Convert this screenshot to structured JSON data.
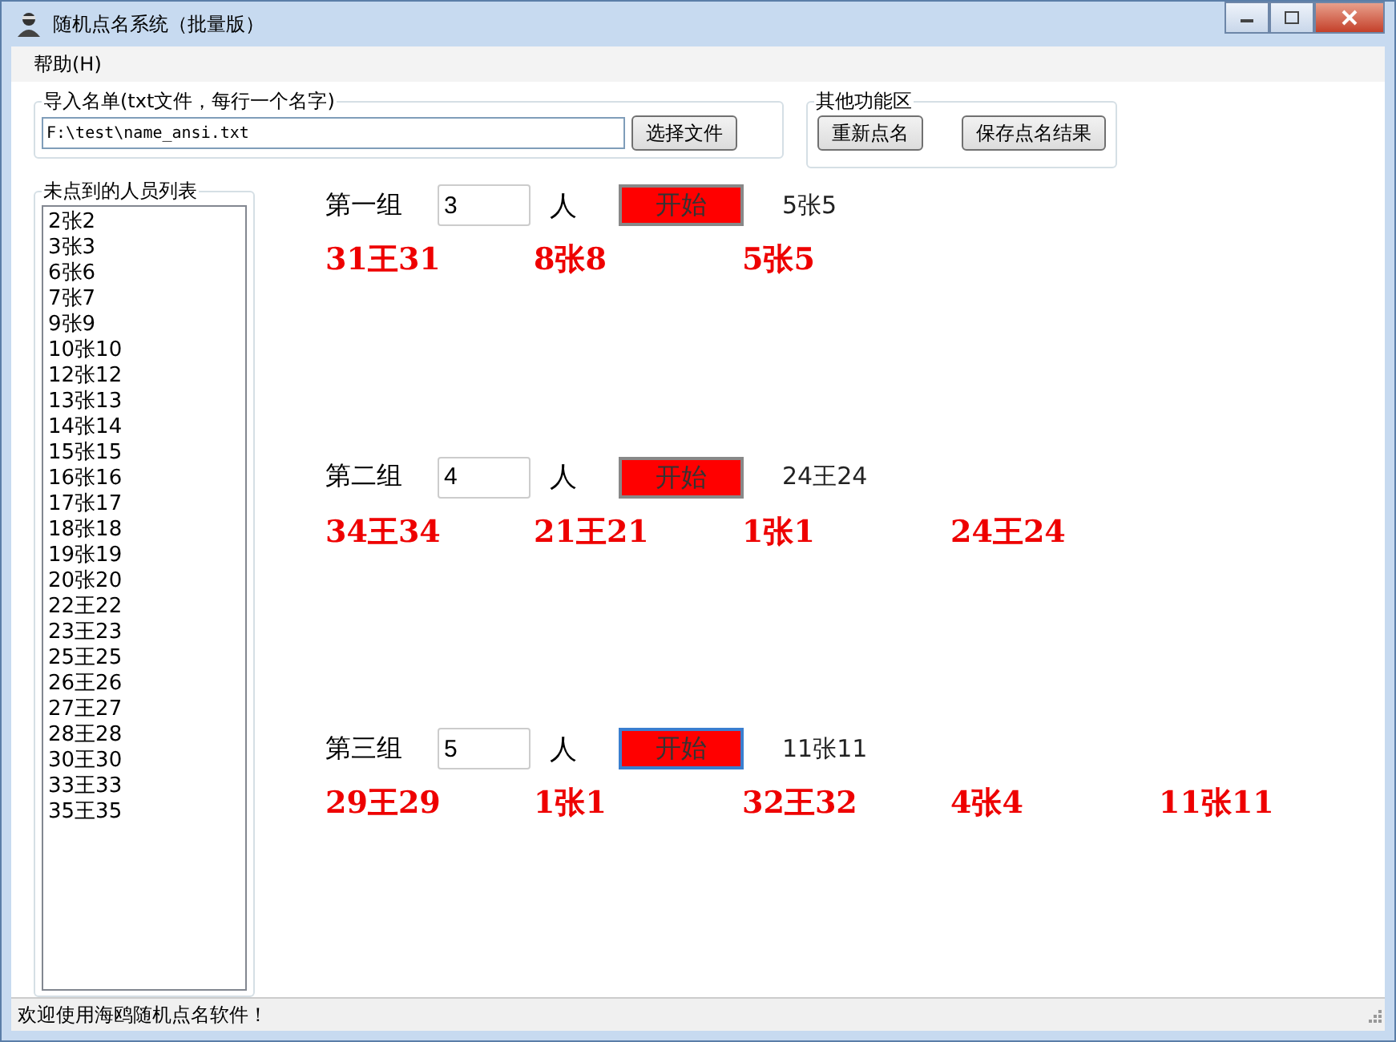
{
  "window": {
    "title": "随机点名系统（批量版）"
  },
  "menu": [
    "帮助(H)"
  ],
  "import": {
    "legend": "导入名单(txt文件，每行一个名字)",
    "path": "F:\\test\\name_ansi.txt",
    "button": "选择文件"
  },
  "other": {
    "legend": "其他功能区",
    "buttons": [
      "重新点名",
      "保存点名结果"
    ]
  },
  "list": {
    "legend": "未点到的人员列表",
    "items": [
      "2张2",
      "3张3",
      "6张6",
      "7张7",
      "9张9",
      "10张10",
      "12张12",
      "13张13",
      "14张14",
      "15张15",
      "16张16",
      "17张17",
      "18张18",
      "19张19",
      "20张20",
      "22王22",
      "23王23",
      "25王25",
      "26王26",
      "27王27",
      "28王28",
      "30王30",
      "33王33",
      "35王35"
    ]
  },
  "groups": [
    {
      "label": "第一组",
      "count": "3",
      "unit": "人",
      "button": "开始",
      "focused": false,
      "last": "5张5",
      "results": [
        "31王31",
        "8张8",
        "5张5"
      ]
    },
    {
      "label": "第二组",
      "count": "4",
      "unit": "人",
      "button": "开始",
      "focused": false,
      "last": "24王24",
      "results": [
        "34王34",
        "21王21",
        "1张1",
        "24王24"
      ]
    },
    {
      "label": "第三组",
      "count": "5",
      "unit": "人",
      "button": "开始",
      "focused": true,
      "last": "11张11",
      "results": [
        "29王29",
        "1张1",
        "32王32",
        "4张4",
        "11张11"
      ]
    }
  ],
  "status_bar": "欢迎使用海鸥随机点名软件！"
}
